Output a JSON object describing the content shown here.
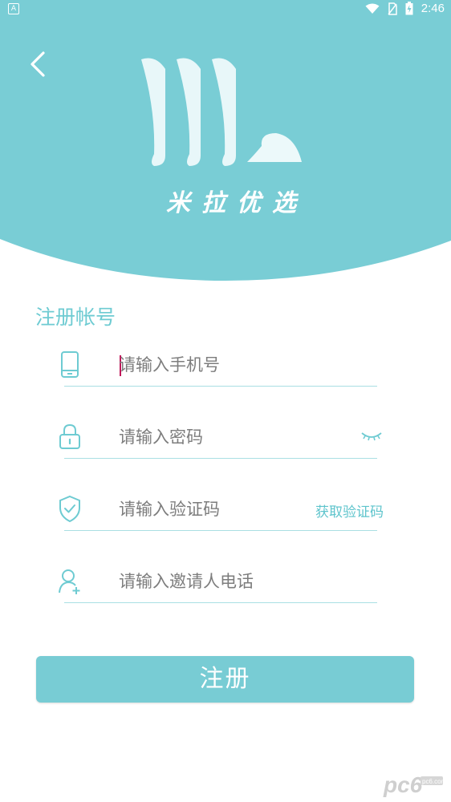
{
  "status_bar": {
    "notification_icon_text": "A",
    "time": "2:46",
    "icons": [
      "wifi-icon",
      "no-sim-icon",
      "battery-icon"
    ]
  },
  "header": {
    "brand_name": "米拉优选",
    "back_icon": "back-chevron-icon",
    "logo_icon": "ml-logo-icon"
  },
  "form": {
    "title": "注册帐号",
    "phone": {
      "placeholder": "请输入手机号",
      "value": "",
      "icon": "phone-icon"
    },
    "password": {
      "placeholder": "请输入密码",
      "value": "",
      "icon": "lock-icon",
      "toggle_icon": "eye-closed-icon"
    },
    "code": {
      "placeholder": "请输入验证码",
      "value": "",
      "icon": "shield-icon",
      "get_code_label": "获取验证码"
    },
    "inviter": {
      "placeholder": "请输入邀请人电话",
      "value": "",
      "icon": "add-user-icon"
    },
    "submit_label": "注册"
  },
  "watermark": {
    "text": "pc6",
    "sub_text": "pc6.com",
    "icon": "pc6-watermark-icon"
  },
  "colors": {
    "accent": "#78ccd4",
    "header_bg": "#79cdd5",
    "line": "#a9dfe3",
    "caret": "#c0185a"
  }
}
